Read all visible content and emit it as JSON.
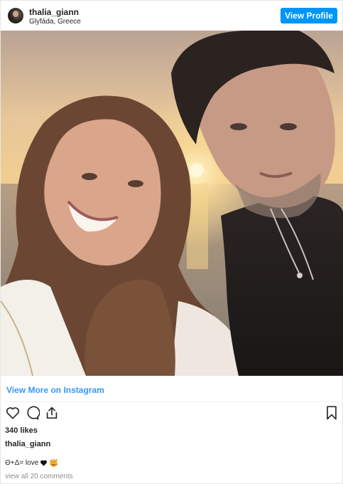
{
  "header": {
    "username": "thalia_giann",
    "location": "Glyfáda, Greece",
    "view_profile_label": "View Profile"
  },
  "photo": {
    "alt": ""
  },
  "footer": {
    "view_more_label": "View More on Instagram",
    "likes": "340 likes",
    "owner": "thalia_giann",
    "caption": "Θ+Δ= love",
    "caption_emojis": [
      "black-heart",
      "smiling-face-with-hearts"
    ],
    "comments_link": "view all 20 comments"
  },
  "colors": {
    "accent": "#0095f6",
    "link": "#3897f0",
    "muted": "#8e8e8e"
  },
  "icons": [
    "heart-icon",
    "comment-icon",
    "share-icon",
    "bookmark-icon"
  ]
}
